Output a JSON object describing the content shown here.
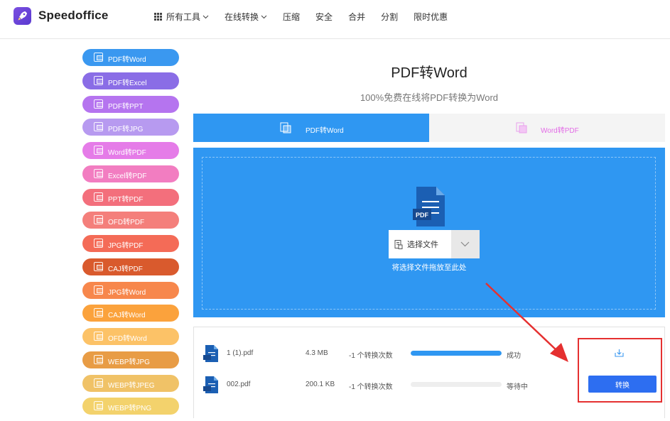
{
  "header": {
    "brand": "Speedoffice",
    "nav": [
      {
        "label": "所有工具",
        "has_grid": true,
        "has_chevron": true
      },
      {
        "label": "在线转换",
        "has_grid": false,
        "has_chevron": true
      },
      {
        "label": "压缩",
        "has_grid": false,
        "has_chevron": false
      },
      {
        "label": "安全",
        "has_grid": false,
        "has_chevron": false
      },
      {
        "label": "合并",
        "has_grid": false,
        "has_chevron": false
      },
      {
        "label": "分割",
        "has_grid": false,
        "has_chevron": false
      },
      {
        "label": "限时优惠",
        "has_grid": false,
        "has_chevron": false
      }
    ]
  },
  "sidebar": {
    "items": [
      {
        "label": "PDF转Word",
        "color": "#3a98f0"
      },
      {
        "label": "PDF转Excel",
        "color": "#8a6de6"
      },
      {
        "label": "PDF转PPT",
        "color": "#b574ef"
      },
      {
        "label": "PDF转JPG",
        "color": "#b79af0"
      },
      {
        "label": "Word转PDF",
        "color": "#e57ce8"
      },
      {
        "label": "Excel转PDF",
        "color": "#f27dc1"
      },
      {
        "label": "PPT转PDF",
        "color": "#f36f7c"
      },
      {
        "label": "OFD转PDF",
        "color": "#f47f7b"
      },
      {
        "label": "JPG转PDF",
        "color": "#f46b57"
      },
      {
        "label": "CAJ转PDF",
        "color": "#d95a2d"
      },
      {
        "label": "JPG转Word",
        "color": "#f7874c"
      },
      {
        "label": "CAJ转Word",
        "color": "#fba23c"
      },
      {
        "label": "OFD转Word",
        "color": "#fcc267"
      },
      {
        "label": "WEBP转JPG",
        "color": "#e89c45"
      },
      {
        "label": "WEBP转JPEG",
        "color": "#f0c267"
      },
      {
        "label": "WEBP转PNG",
        "color": "#f3d26c"
      }
    ]
  },
  "main": {
    "title": "PDF转Word",
    "subtitle": "100%免费在线将PDF转换为Word",
    "tabs": [
      {
        "label": "PDF转Word",
        "active": true
      },
      {
        "label": "Word转PDF",
        "active": false
      }
    ],
    "dropzone": {
      "file_badge": "PDF",
      "select_label": "选择文件",
      "hint": "将选择文件拖放至此处"
    }
  },
  "files": [
    {
      "name": "1 (1).pdf",
      "size": "4.3 MB",
      "count": "-1 个转换次数",
      "progress": 1.0,
      "status": "成功",
      "action": "download"
    },
    {
      "name": "002.pdf",
      "size": "200.1 KB",
      "count": "-1 个转换次数",
      "progress": 0.0,
      "status": "等待中",
      "action": "convert",
      "action_label": "转换"
    }
  ],
  "colors": {
    "accent": "#2f97f2",
    "convert_button": "#2d6ef1",
    "annotation_red": "#e53030"
  }
}
